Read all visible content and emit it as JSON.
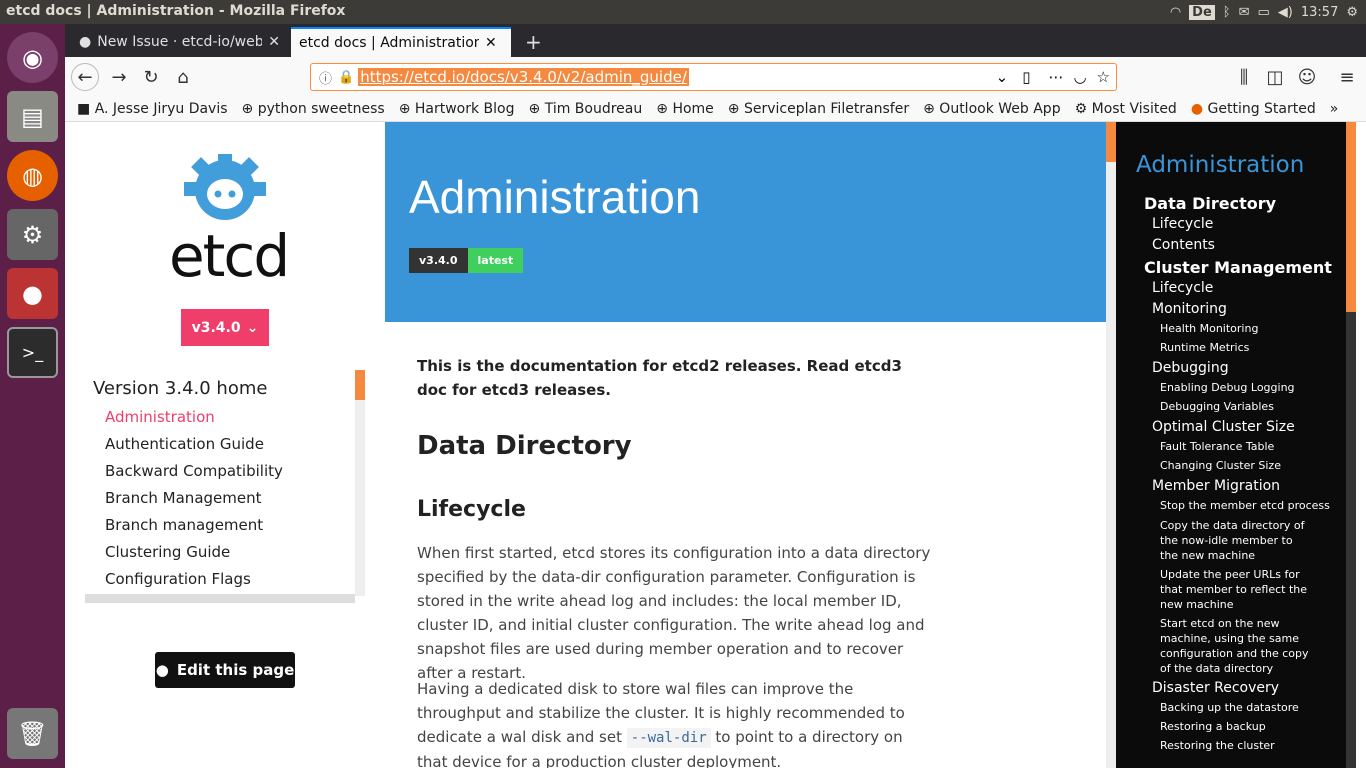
{
  "window": {
    "title": "etcd docs | Administration - Mozilla Firefox"
  },
  "system": {
    "lang": "De",
    "clock": "13:57"
  },
  "tabs": [
    {
      "label": "New Issue · etcd-io/website"
    },
    {
      "label": "etcd docs | Administration"
    }
  ],
  "url": "https://etcd.io/docs/v3.4.0/v2/admin_guide/",
  "bookmarks": [
    "A. Jesse Jiryu Davis",
    "python sweetness",
    "Hartwork Blog",
    "Tim Boudreau",
    "Home",
    "Serviceplan Filetransfer",
    "Outlook Web App",
    "Most Visited",
    "Getting Started"
  ],
  "sidebar": {
    "logo": "etcd",
    "version": "v3.4.0",
    "home": "Version 3.4.0 home",
    "items": [
      "Administration",
      "Authentication Guide",
      "Backward Compatibility",
      "Branch Management",
      "Branch management",
      "Clustering Guide",
      "Configuration Flags"
    ],
    "edit": "Edit this page"
  },
  "hero": {
    "title": "Administration",
    "version": "v3.4.0",
    "latest": "latest"
  },
  "content": {
    "lead": "This is the documentation for etcd2 releases. Read etcd3 doc for etcd3 releases.",
    "h2": "Data Directory",
    "h3": "Lifecycle",
    "p1": "When first started, etcd stores its configuration into a data directory specified by the data-dir configuration parameter. Configuration is stored in the write ahead log and includes: the local member ID, cluster ID, and initial cluster configuration. The write ahead log and snapshot files are used during member operation and to recover after a restart.",
    "p2a": "Having a dedicated disk to store wal files can improve the throughput and stabilize the cluster. It is highly recommended to dedicate a wal disk and set",
    "code": "--wal-dir",
    "p2b": "to point to a directory on that device for a production cluster deployment."
  },
  "toc": {
    "title": "Administration",
    "items": [
      {
        "t": "Data Directory",
        "l": 1
      },
      {
        "t": "Lifecycle",
        "l": 2
      },
      {
        "t": "Contents",
        "l": 2
      },
      {
        "t": "Cluster Management",
        "l": 1
      },
      {
        "t": "Lifecycle",
        "l": 2
      },
      {
        "t": "Monitoring",
        "l": 2
      },
      {
        "t": "Health Monitoring",
        "l": 3
      },
      {
        "t": "Runtime Metrics",
        "l": 3
      },
      {
        "t": "Debugging",
        "l": 2
      },
      {
        "t": "Enabling Debug Logging",
        "l": 3
      },
      {
        "t": "Debugging Variables",
        "l": 3
      },
      {
        "t": "Optimal Cluster Size",
        "l": 2
      },
      {
        "t": "Fault Tolerance Table",
        "l": 3
      },
      {
        "t": "Changing Cluster Size",
        "l": 3
      },
      {
        "t": "Member Migration",
        "l": 2
      },
      {
        "t": "Stop the member etcd process",
        "l": 3
      },
      {
        "t": "Copy the data directory of the now-idle member to the new machine",
        "l": 3
      },
      {
        "t": "Update the peer URLs for that member to reflect the new machine",
        "l": 3
      },
      {
        "t": "Start etcd on the new machine, using the same configuration and the copy of the data directory",
        "l": 3
      },
      {
        "t": "Disaster Recovery",
        "l": 2
      },
      {
        "t": "Backing up the datastore",
        "l": 3
      },
      {
        "t": "Restoring a backup",
        "l": 3
      },
      {
        "t": "Restoring the cluster",
        "l": 3
      }
    ]
  }
}
